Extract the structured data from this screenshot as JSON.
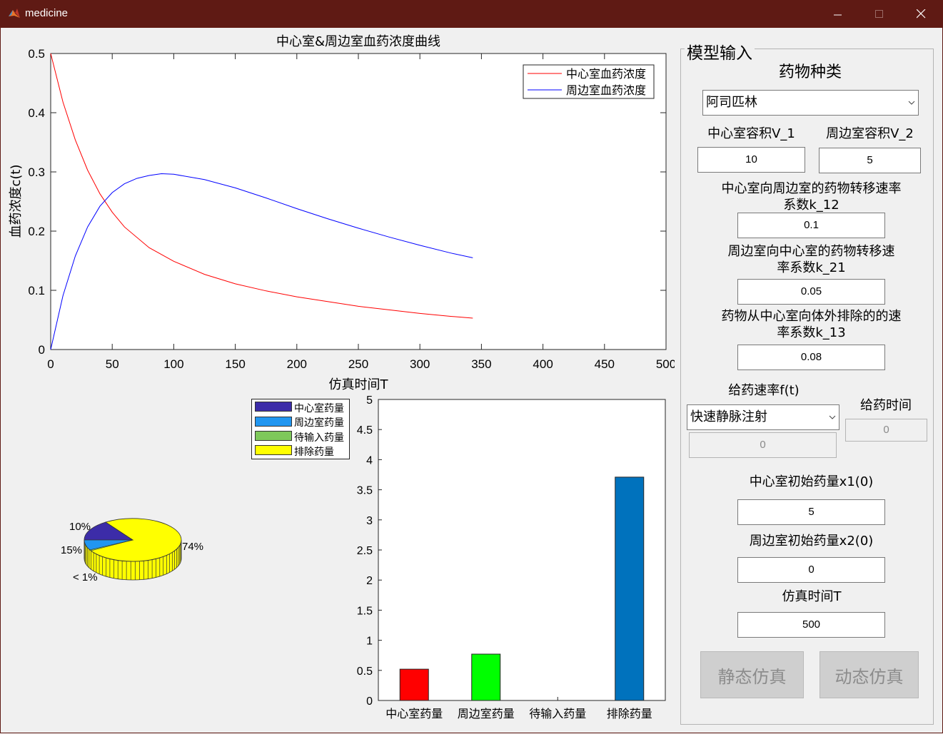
{
  "window": {
    "title": "medicine"
  },
  "line_chart": {
    "title": "中心室&周边室血药浓度曲线",
    "xlabel": "仿真时间T",
    "ylabel": "血药浓度c(t)",
    "legend": [
      "中心室血药浓度",
      "周边室血药浓度"
    ],
    "series_colors": [
      "#ff0000",
      "#0000ff"
    ]
  },
  "pie_chart": {
    "labels": [
      "10%",
      "15%",
      "< 1%",
      "74%"
    ]
  },
  "bar_chart": {
    "legend": [
      "中心室药量",
      "周边室药量",
      "待输入药量",
      "排除药量"
    ],
    "legend_colors": [
      "#3c2ca8",
      "#2196f0",
      "#7ec85a",
      "#ffff00"
    ]
  },
  "chart_data": [
    {
      "type": "line",
      "title": "中心室&周边室血药浓度曲线",
      "xlabel": "仿真时间T",
      "ylabel": "血药浓度c(t)",
      "xlim": [
        0,
        500
      ],
      "ylim": [
        0,
        0.5
      ],
      "xticks": [
        0,
        50,
        100,
        150,
        200,
        250,
        300,
        350,
        400,
        450,
        500
      ],
      "yticks": [
        0,
        0.1,
        0.2,
        0.3,
        0.4,
        0.5
      ],
      "legend_position": "top-right",
      "series": [
        {
          "name": "中心室血药浓度",
          "color": "#ff0000",
          "x": [
            0,
            10,
            20,
            30,
            40,
            50,
            60,
            80,
            100,
            125,
            150,
            175,
            200,
            225,
            250,
            275,
            300,
            325,
            343
          ],
          "y": [
            0.5,
            0.418,
            0.354,
            0.303,
            0.263,
            0.232,
            0.207,
            0.172,
            0.149,
            0.127,
            0.111,
            0.099,
            0.089,
            0.081,
            0.073,
            0.067,
            0.061,
            0.056,
            0.053
          ]
        },
        {
          "name": "周边室血药浓度",
          "color": "#0000ff",
          "x": [
            0,
            10,
            20,
            30,
            40,
            50,
            60,
            70,
            80,
            90,
            100,
            125,
            150,
            175,
            200,
            225,
            250,
            275,
            300,
            325,
            343
          ],
          "y": [
            0,
            0.091,
            0.158,
            0.207,
            0.242,
            0.265,
            0.28,
            0.289,
            0.294,
            0.297,
            0.296,
            0.287,
            0.273,
            0.256,
            0.238,
            0.221,
            0.205,
            0.19,
            0.176,
            0.163,
            0.155
          ]
        }
      ]
    },
    {
      "type": "pie",
      "labels": [
        "10%",
        "15%",
        "< 1%",
        "74%"
      ],
      "values": [
        10,
        15,
        0.5,
        74.5
      ],
      "colors": [
        "#3c2ca8",
        "#2196f0",
        "#7ec85a",
        "#ffff00"
      ]
    },
    {
      "type": "bar",
      "categories": [
        "中心室药量",
        "周边室药量",
        "待输入药量",
        "排除药量"
      ],
      "values": [
        0.52,
        0.77,
        0,
        3.71
      ],
      "colors": [
        "#ff0000",
        "#00ff00",
        "#00ff00",
        "#0072bd"
      ],
      "ylim": [
        0,
        5
      ],
      "yticks": [
        0,
        0.5,
        1,
        1.5,
        2,
        2.5,
        3,
        3.5,
        4,
        4.5,
        5
      ]
    }
  ],
  "panel": {
    "title": "模型输入",
    "drug_type_label": "药物种类",
    "drug_type_value": "阿司匹林",
    "v1_label": "中心室容积V_1",
    "v1_value": "10",
    "v2_label": "周边室容积V_2",
    "v2_value": "5",
    "k12_label_line1": "中心室向周边室的药物转移速率",
    "k12_label_line2": "系数k_12",
    "k12_value": "0.1",
    "k21_label_line1": "周边室向中心室的药物转移速",
    "k21_label_line2": "率系数k_21",
    "k21_value": "0.05",
    "k13_label_line1": "药物从中心室向体外排除的的速",
    "k13_label_line2": "率系数k_13",
    "k13_value": "0.08",
    "rate_label": "给药速率f(t)",
    "rate_select_value": "快速静脉注射",
    "rate_value": "0",
    "time_label": "给药时间",
    "time_value": "0",
    "x1_label": "中心室初始药量x1(0)",
    "x1_value": "5",
    "x2_label": "周边室初始药量x2(0)",
    "x2_value": "0",
    "T_label": "仿真时间T",
    "T_value": "500",
    "static_button": "静态仿真",
    "dynamic_button": "动态仿真"
  }
}
